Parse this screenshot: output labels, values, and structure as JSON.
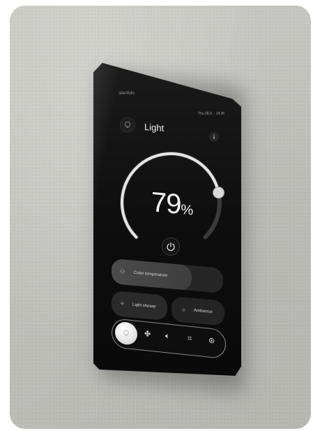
{
  "header": {
    "brand": "sitenfuto",
    "datetime": "Thu 28.9. · 14:26"
  },
  "panel": {
    "title": "Light",
    "brightness_value": "79",
    "brightness_unit": "%",
    "brightness_fraction": 0.79
  },
  "controls": {
    "color_temperature_label": "Color temperature",
    "color_temperature_fraction": 0.72,
    "light_shower_label": "Light shower",
    "ambience_label": "Ambience"
  },
  "nav": {
    "items": [
      {
        "icon": "bulb-icon",
        "active": true
      },
      {
        "icon": "fan-icon",
        "active": false
      },
      {
        "icon": "speaker-icon",
        "active": false
      },
      {
        "icon": "blinds-icon",
        "active": false
      },
      {
        "icon": "settings-icon",
        "active": false
      }
    ]
  },
  "colors": {
    "accent": "#e9e9e9",
    "device_body": "#0d0d0d",
    "wall": "#c4c4bf"
  }
}
